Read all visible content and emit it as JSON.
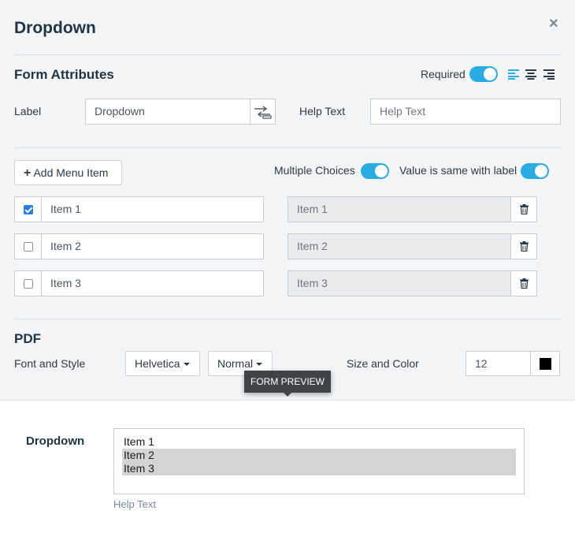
{
  "dialog": {
    "title": "Dropdown",
    "close_glyph": "×"
  },
  "form_attributes": {
    "heading": "Form Attributes",
    "required_label": "Required",
    "required_on": true,
    "label_label": "Label",
    "label_value": "Dropdown",
    "help_text_label": "Help Text",
    "help_text_placeholder": "Help Text",
    "alignment_options": [
      "align-left-icon",
      "align-center-icon",
      "align-right-icon"
    ],
    "alignment_selected": "left"
  },
  "menu": {
    "add_button_label": "Add Menu Item",
    "multiple_choices_label": "Multiple Choices",
    "multiple_choices_on": true,
    "value_same_label": "Value is same with label",
    "value_same_on": true,
    "items": [
      {
        "label": "Item 1",
        "value": "Item 1",
        "checked": true
      },
      {
        "label": "Item 2",
        "value": "Item 2",
        "checked": false
      },
      {
        "label": "Item 3",
        "value": "Item 3",
        "checked": false
      }
    ]
  },
  "pdf": {
    "heading": "PDF",
    "font_style_label": "Font and Style",
    "font": "Helvetica",
    "style": "Normal",
    "size_color_label": "Size and Color",
    "size": "12",
    "color": "#000000"
  },
  "tooltip": {
    "text": "FORM PREVIEW"
  },
  "preview": {
    "label": "Dropdown",
    "options": [
      "Item 1",
      "Item 2",
      "Item 3"
    ],
    "selected": [
      false,
      true,
      true
    ],
    "help_text": "Help Text"
  },
  "colors": {
    "accent": "#2aace2",
    "checkbox": "#2a7de1",
    "panel_bg": "#f4f5f6"
  }
}
